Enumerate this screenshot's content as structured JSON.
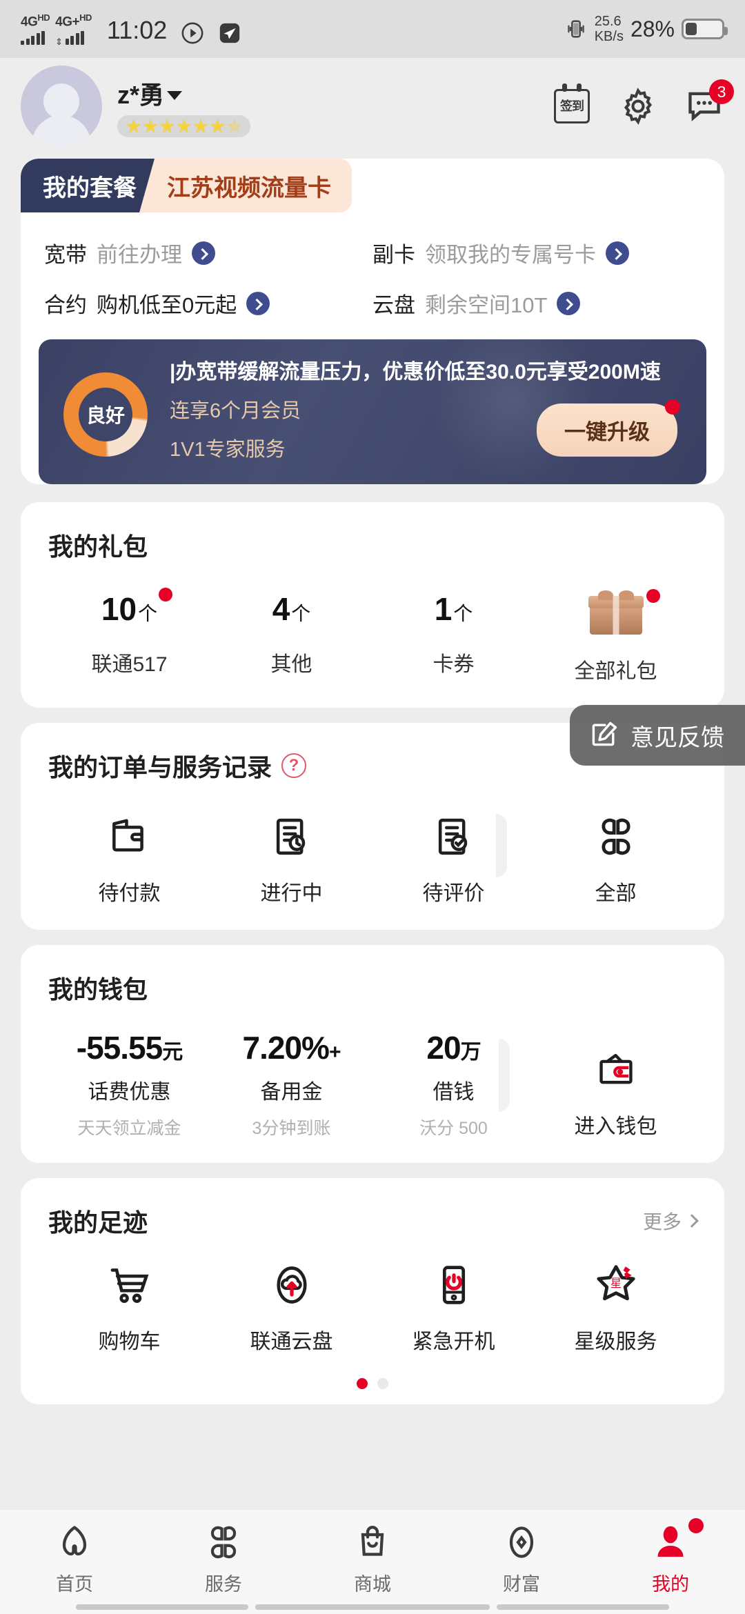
{
  "status_bar": {
    "net1": "4G",
    "net1_sup": "HD",
    "net2": "4G+",
    "net2_sup": "HD",
    "time": "11:02",
    "speed": "25.6",
    "speed_unit": "KB/s",
    "battery_pct": "28%"
  },
  "header": {
    "username": "z*勇",
    "stars": "★★★★★★★",
    "message_badge": "3",
    "signin_label": "签到"
  },
  "package": {
    "tab_active": "我的套餐",
    "tab_next": "江苏视频流量卡",
    "rows": [
      {
        "label": "宽带",
        "value": "前往办理"
      },
      {
        "label": "副卡",
        "value": "领取我的专属号卡"
      },
      {
        "label": "合约",
        "value": "购机低至0元起"
      },
      {
        "label": "云盘",
        "value": "剩余空间10T"
      }
    ],
    "promo": {
      "gauge_text": "良好",
      "line1": "|办宽带缓解流量压力，优惠价低至30.0元享受200M速",
      "line2": "连享6个月会员",
      "line3": "1V1专家服务",
      "button": "一键升级"
    }
  },
  "gift": {
    "title": "我的礼包",
    "items": [
      {
        "num": "10",
        "unit": "个",
        "label": "联通517",
        "dot": true
      },
      {
        "num": "4",
        "unit": "个",
        "label": "其他",
        "dot": false
      },
      {
        "num": "1",
        "unit": "个",
        "label": "卡券",
        "dot": false
      }
    ],
    "all_label": "全部礼包"
  },
  "orders": {
    "title": "我的订单与服务记录",
    "help": "?",
    "items": [
      {
        "label": "待付款",
        "icon": "wallet-outline-icon"
      },
      {
        "label": "进行中",
        "icon": "doc-clock-icon"
      },
      {
        "label": "待评价",
        "icon": "doc-check-icon"
      },
      {
        "label": "全部",
        "icon": "grid-four-icon"
      }
    ]
  },
  "wallet": {
    "title": "我的钱包",
    "items": [
      {
        "num": "-55.55",
        "unit": "元",
        "label": "话费优惠",
        "sub": "天天领立减金"
      },
      {
        "num": "7.20%",
        "unit": "+",
        "label": "备用金",
        "sub": "3分钟到账"
      },
      {
        "num": "20",
        "unit": "万",
        "label": "借钱",
        "sub": "沃分 500"
      }
    ],
    "enter_label": "进入钱包"
  },
  "footprint": {
    "title": "我的足迹",
    "more": "更多",
    "items": [
      {
        "label": "购物车",
        "icon": "shopping-cart-icon"
      },
      {
        "label": "联通云盘",
        "icon": "cloud-upload-icon"
      },
      {
        "label": "紧急开机",
        "icon": "emergency-power-icon"
      },
      {
        "label": "星级服务",
        "icon": "star-service-icon"
      }
    ],
    "dots": [
      true,
      false
    ]
  },
  "feedback": {
    "label": "意见反馈",
    "icon": "edit-feedback-icon"
  },
  "navbar": {
    "items": [
      {
        "label": "首页",
        "icon": "home-icon",
        "active": false,
        "dot": false
      },
      {
        "label": "服务",
        "icon": "grid-four-icon",
        "active": false,
        "dot": false
      },
      {
        "label": "商城",
        "icon": "shopping-bag-icon",
        "active": false,
        "dot": false
      },
      {
        "label": "财富",
        "icon": "coin-icon",
        "active": false,
        "dot": false
      },
      {
        "label": "我的",
        "icon": "user-icon",
        "active": true,
        "dot": true
      }
    ]
  },
  "colors": {
    "accent": "#e60026",
    "dark_navy": "#323a5e",
    "orange": "#ef8c35",
    "peach": "#fbe6d8"
  }
}
